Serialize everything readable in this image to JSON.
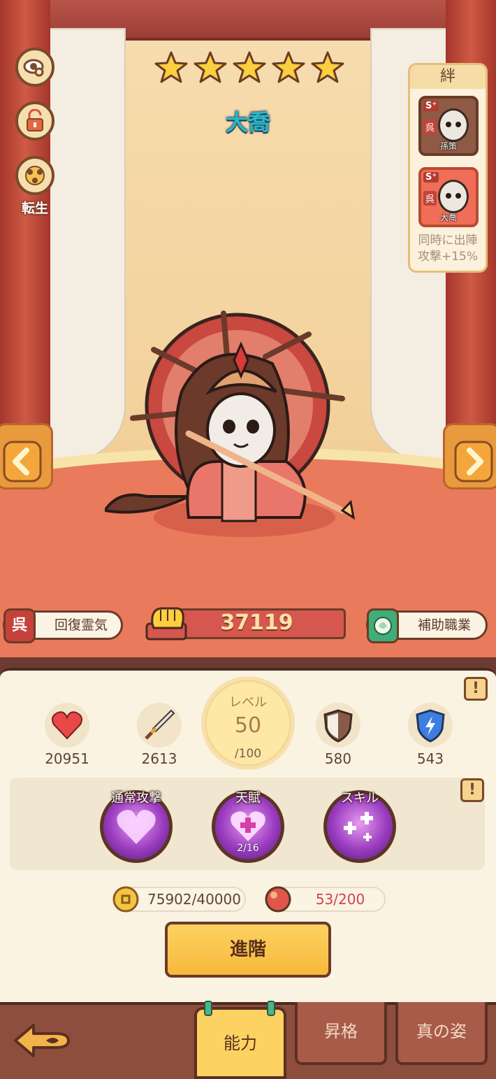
{
  "stage": {
    "stars": 5,
    "hero_name": "大喬",
    "rebirth_label": "転生",
    "bond": {
      "title": "絆",
      "cards": [
        {
          "grade": "S⁺",
          "faction": "呉",
          "name": "孫策"
        },
        {
          "grade": "S⁺",
          "faction": "呉",
          "name": "大喬"
        }
      ],
      "bonus_line1": "同時に出陣",
      "bonus_line2": "攻撃+15%"
    }
  },
  "strip": {
    "faction": "呉",
    "type_label": "回復霊気",
    "power": "37119",
    "role_label": "補助職業"
  },
  "stats": {
    "hp": "20951",
    "attack": "2613",
    "level_label": "レベル",
    "level": "50",
    "level_max": "/100",
    "defense": "580",
    "magic_defense": "543"
  },
  "skills": [
    {
      "label": "通常攻撃",
      "sub": ""
    },
    {
      "label": "天賦",
      "sub": "2/16"
    },
    {
      "label": "スキル",
      "sub": ""
    }
  ],
  "costs": {
    "gold": "75902/40000",
    "orb": "53/200"
  },
  "advance_label": "進階",
  "tabs": [
    {
      "label": "能力",
      "active": true
    },
    {
      "label": "昇格",
      "active": false
    },
    {
      "label": "真の姿",
      "active": false
    }
  ],
  "colors": {
    "hero_name": "#2cb6c7",
    "power_bar": "#d55750",
    "primary_button": "#f6b93a",
    "orb_cost_text": "#d0454a"
  }
}
